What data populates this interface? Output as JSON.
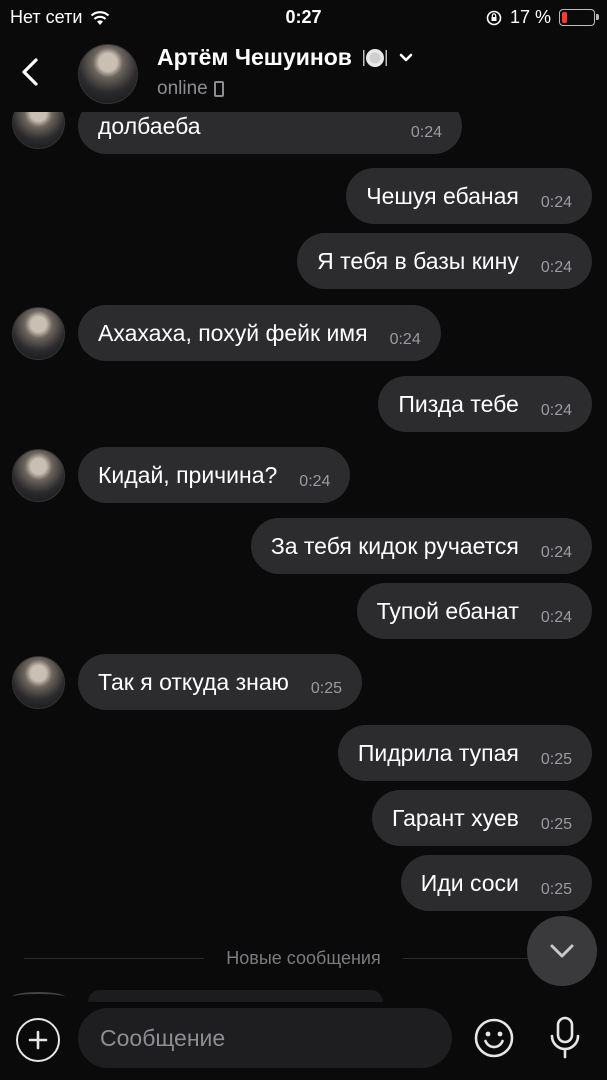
{
  "status_bar": {
    "carrier": "Нет сети",
    "time": "0:27",
    "battery": "17 %",
    "battery_level": 0.17
  },
  "header": {
    "contact_name": "Артём Чешуинов",
    "status": "online"
  },
  "messages": [
    {
      "text": "долбаеба",
      "time": "0:24",
      "incoming": true
    },
    {
      "text": "Чешуя ебаная",
      "time": "0:24",
      "incoming": false
    },
    {
      "text": "Я тебя в базы кину",
      "time": "0:24",
      "incoming": false
    },
    {
      "text": "Ахахаха, похуй фейк имя",
      "time": "0:24",
      "incoming": true
    },
    {
      "text": "Пизда тебе",
      "time": "0:24",
      "incoming": false
    },
    {
      "text": "Кидай, причина?",
      "time": "0:24",
      "incoming": true
    },
    {
      "text": "За тебя кидок ручается",
      "time": "0:24",
      "incoming": false
    },
    {
      "text": "Тупой ебанат",
      "time": "0:24",
      "incoming": false
    },
    {
      "text": "Так я откуда знаю",
      "time": "0:25",
      "incoming": true
    },
    {
      "text": "Пидрила тупая",
      "time": "0:25",
      "incoming": false
    },
    {
      "text": "Гарант хуев",
      "time": "0:25",
      "incoming": false
    },
    {
      "text": "Иди соси",
      "time": "0:25",
      "incoming": false
    }
  ],
  "new_messages_divider": "Новые сообщения",
  "composer": {
    "placeholder": "Сообщение"
  },
  "icons": {
    "back": "chevron-left-icon",
    "wifi": "wifi-icon",
    "rotation_lock": "rotation-lock-icon",
    "dish": "plate-icon",
    "expand": "chevron-down-icon",
    "device": "phone-icon",
    "scroll_down": "chevron-down-icon",
    "attach": "plus-icon",
    "emoji": "smile-icon",
    "mic": "mic-icon"
  },
  "colors": {
    "background": "#0a0a0a",
    "bubble": "#2c2c2e",
    "secondary_text": "#8d8d92",
    "battery_low": "#ff3b30"
  }
}
